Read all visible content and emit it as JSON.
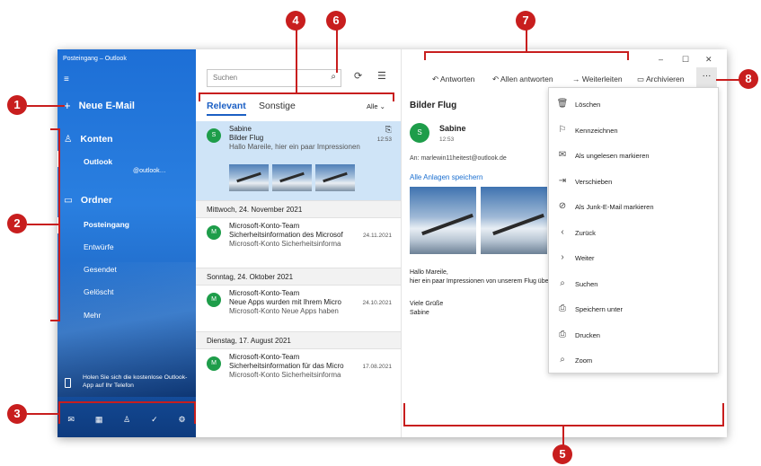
{
  "window_title": "Posteingang – Outlook",
  "sidebar": {
    "hamburger": "≡",
    "new_mail": "Neue E-Mail",
    "accounts_label": "Konten",
    "account_name": "Outlook",
    "account_email": "@outlook…",
    "folders_label": "Ordner",
    "folders": [
      "Posteingang",
      "Entwürfe",
      "Gesendet",
      "Gelöscht",
      "Mehr"
    ],
    "promo": "Holen Sie sich die kostenlose Outlook-App auf Ihr Telefon",
    "nav_icons": [
      "mail-icon",
      "calendar-icon",
      "people-icon",
      "todo-icon",
      "settings-icon"
    ]
  },
  "list": {
    "search_placeholder": "Suchen",
    "tab_relevant": "Relevant",
    "tab_other": "Sonstige",
    "filter": "Alle",
    "selected": {
      "avatar": "S",
      "from": "Sabine",
      "subject": "Bilder Flug",
      "preview": "Hallo Mareile, hier ein paar Impressionen",
      "time": "12:53"
    },
    "groups": [
      {
        "date": "Mittwoch, 24. November 2021",
        "avatar": "M",
        "from": "Microsoft-Konto-Team",
        "subject": "Sicherheitsinformation des Microsof",
        "preview": "Microsoft-Konto Sicherheitsinforma",
        "time": "24.11.2021"
      },
      {
        "date": "Sonntag, 24. Oktober 2021",
        "avatar": "M",
        "from": "Microsoft-Konto-Team",
        "subject": "Neue Apps wurden mit Ihrem Micro",
        "preview": "Microsoft-Konto Neue Apps haben",
        "time": "24.10.2021"
      },
      {
        "date": "Dienstag, 17. August 2021",
        "avatar": "M",
        "from": "Microsoft-Konto-Team",
        "subject": "Sicherheitsinformation für das Micro",
        "preview": "Microsoft-Konto Sicherheitsinforma",
        "time": "17.08.2021"
      }
    ]
  },
  "reader": {
    "actions": [
      "Antworten",
      "Allen antworten",
      "Weiterleiten",
      "Archivieren"
    ],
    "more": "···",
    "subject": "Bilder Flug",
    "avatar": "S",
    "from": "Sabine",
    "time": "12:53",
    "to": "An: marlewin11heitest@outlook.de",
    "save_attachments": "Alle Anlagen speichern",
    "body_line1": "Hallo Mareile,",
    "body_line2": "hier ein paar Impressionen von unserem Flug über die Alpen.",
    "sig_line1": "Viele Grüße",
    "sig_line2": "Sabine"
  },
  "menu": [
    {
      "icon": "delete-icon",
      "glyph": "🗑",
      "label": "Löschen"
    },
    {
      "icon": "flag-icon",
      "glyph": "⚐",
      "label": "Kennzeichnen"
    },
    {
      "icon": "envelope-icon",
      "glyph": "✉",
      "label": "Als ungelesen markieren"
    },
    {
      "icon": "move-icon",
      "glyph": "⇥",
      "label": "Verschieben"
    },
    {
      "icon": "junk-icon",
      "glyph": "⊘",
      "label": "Als Junk-E-Mail markieren"
    },
    {
      "icon": "back-icon",
      "glyph": "‹",
      "label": "Zurück"
    },
    {
      "icon": "forward-icon",
      "glyph": "›",
      "label": "Weiter"
    },
    {
      "icon": "search-icon",
      "glyph": "⌕",
      "label": "Suchen"
    },
    {
      "icon": "save-icon",
      "glyph": "⎙",
      "label": "Speichern unter"
    },
    {
      "icon": "print-icon",
      "glyph": "⎙",
      "label": "Drucken"
    },
    {
      "icon": "zoom-icon",
      "glyph": "⌕",
      "label": "Zoom"
    }
  ],
  "callouts": [
    "1",
    "2",
    "3",
    "4",
    "5",
    "6",
    "7",
    "8"
  ]
}
